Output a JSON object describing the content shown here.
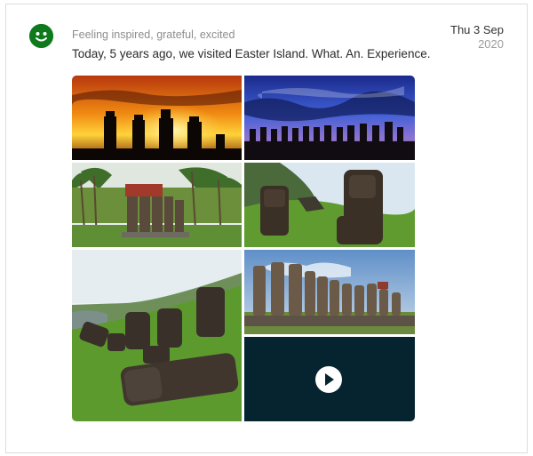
{
  "post": {
    "mood_icon": "smiley-icon",
    "mood": "Feeling inspired, grateful, excited",
    "caption": "Today, 5 years ago, we visited Easter Island. What. An. Experience.",
    "date_day": "Thu 3 Sep",
    "date_year": "2020"
  },
  "media": {
    "photos": [
      "sunset-moai",
      "twilight-moai-row",
      "palm-moai",
      "green-hill-moai",
      "fallen-moai-slope",
      "moai-row-platform"
    ],
    "video": {
      "icon": "play-icon"
    }
  },
  "colors": {
    "mood_icon": "#0f7a1b",
    "video_bg": "#062430"
  }
}
